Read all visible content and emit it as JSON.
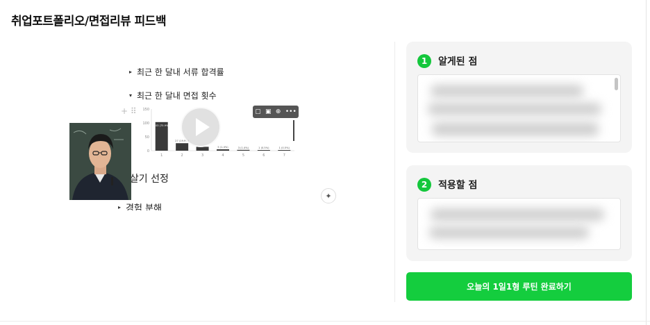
{
  "header": {
    "title": "취업포트폴리오/면접리뷰 피드백"
  },
  "video": {
    "notes": [
      {
        "label": "최근 한 달내 서류 합격률",
        "marker": "▸"
      },
      {
        "label": "최근 한 달내 면접 횟수",
        "marker": "▾"
      },
      {
        "label": "필살기 선정",
        "marker": ""
      },
      {
        "label": "경험 분해",
        "marker": "▸"
      }
    ],
    "chart_data": {
      "type": "bar",
      "categories": [
        "1",
        "2",
        "3",
        "4",
        "5",
        "6",
        "7"
      ],
      "values": [
        103,
        27,
        14,
        5,
        3,
        1,
        1
      ],
      "data_labels": [
        "103 (75.9%)",
        "27 (19.9%)",
        "",
        "5 (1.4%)",
        "3 (1.4%)",
        "1 (0.5%)",
        "1 (0.5%)"
      ],
      "yticks": [
        "150",
        "100",
        "50",
        "0"
      ],
      "ylim": [
        0,
        150
      ]
    },
    "toolbar_icons": [
      "comment-icon",
      "copy-icon",
      "download-icon",
      "more-icon"
    ],
    "play_icon": "play-icon",
    "sparkle_icon": "sparkle-icon"
  },
  "sections": [
    {
      "number": "1",
      "title": "알게된 점"
    },
    {
      "number": "2",
      "title": "적용할 점"
    }
  ],
  "actions": {
    "complete_label": "오늘의 1일1형 루틴 완료하기"
  },
  "colors": {
    "accent": "#14cd3e",
    "card_bg": "#f4f4f4"
  }
}
